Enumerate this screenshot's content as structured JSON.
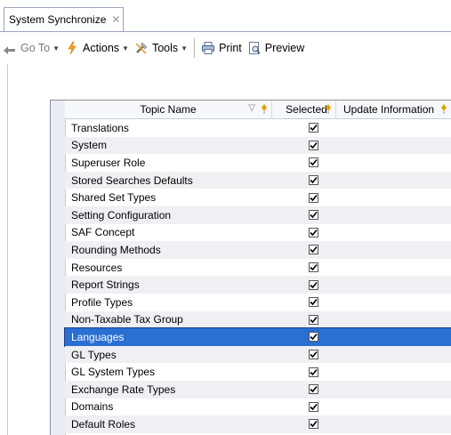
{
  "tab": {
    "title": "System Synchronize",
    "close": "✕"
  },
  "toolbar": {
    "goto_label": "Go To",
    "actions_label": "Actions",
    "tools_label": "Tools",
    "print_label": "Print",
    "preview_label": "Preview"
  },
  "grid": {
    "columns": {
      "topic": "Topic Name",
      "selected": "Selected",
      "update": "Update Information"
    },
    "rows": [
      {
        "topic": "Translations",
        "selected": true
      },
      {
        "topic": "System",
        "selected": true
      },
      {
        "topic": "Superuser Role",
        "selected": true
      },
      {
        "topic": "Stored Searches Defaults",
        "selected": true
      },
      {
        "topic": "Shared Set Types",
        "selected": true
      },
      {
        "topic": "Setting Configuration",
        "selected": true
      },
      {
        "topic": "SAF Concept",
        "selected": true
      },
      {
        "topic": "Rounding Methods",
        "selected": true
      },
      {
        "topic": "Resources",
        "selected": true
      },
      {
        "topic": "Report Strings",
        "selected": true
      },
      {
        "topic": "Profile Types",
        "selected": true
      },
      {
        "topic": "Non-Taxable Tax Group",
        "selected": true
      },
      {
        "topic": "Languages",
        "selected": true,
        "highlighted": true
      },
      {
        "topic": "GL Types",
        "selected": true
      },
      {
        "topic": "GL System Types",
        "selected": true
      },
      {
        "topic": "Exchange Rate Types",
        "selected": true
      },
      {
        "topic": "Domains",
        "selected": true
      },
      {
        "topic": "Default Roles",
        "selected": true
      }
    ]
  },
  "colors": {
    "selection": "#2a6fd1",
    "alt_row": "#eef0f3"
  }
}
